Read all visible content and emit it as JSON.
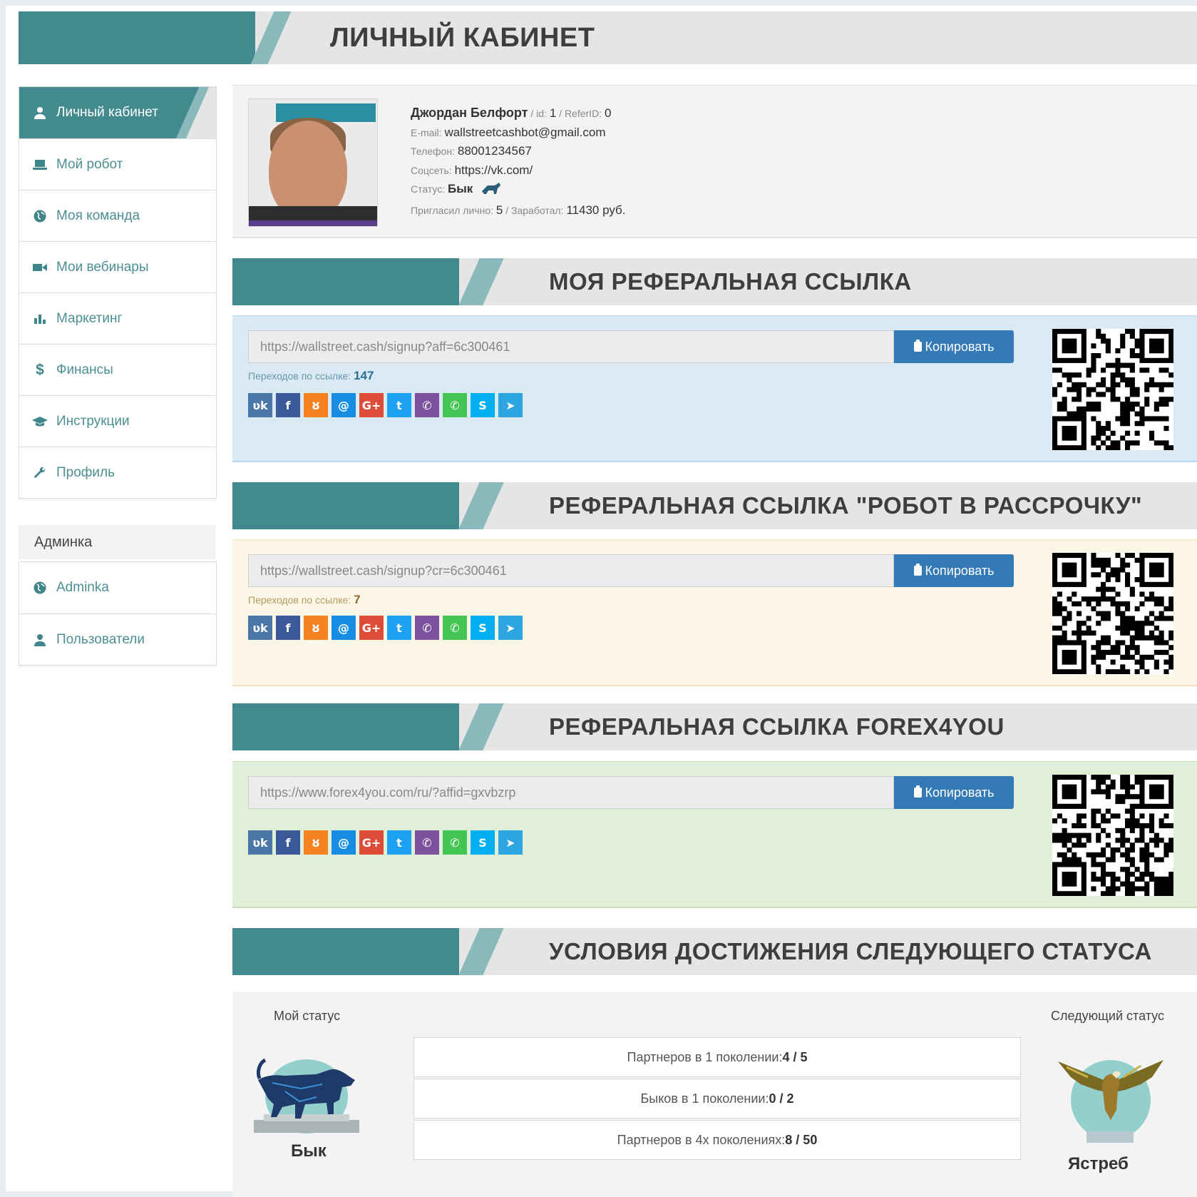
{
  "header": {
    "title": "ЛИЧНЫЙ КАБИНЕТ"
  },
  "sidebar": {
    "items": [
      {
        "label": "Личный кабинет",
        "icon": "user-icon"
      },
      {
        "label": "Мой робот",
        "icon": "laptop-icon"
      },
      {
        "label": "Моя команда",
        "icon": "globe-icon"
      },
      {
        "label": "Мои вебинары",
        "icon": "video-camera-icon"
      },
      {
        "label": "Маркетинг",
        "icon": "bar-chart-icon"
      },
      {
        "label": "Финансы",
        "icon": "dollar-icon"
      },
      {
        "label": "Инструкции",
        "icon": "graduation-cap-icon"
      },
      {
        "label": "Профиль",
        "icon": "wrench-icon"
      }
    ],
    "admin_heading": "Админка",
    "admin_items": [
      {
        "label": "Adminka",
        "icon": "globe-icon"
      },
      {
        "label": "Пользователи",
        "icon": "user-icon"
      }
    ]
  },
  "profile": {
    "name": "Джордан Белфорт",
    "id_label": " / id: ",
    "id": "1",
    "referid_label": " / ReferID: ",
    "referid": "0",
    "email_label": "E-mail: ",
    "email": "wallstreetcashbot@gmail.com",
    "phone_label": "Телефон: ",
    "phone": "88001234567",
    "social_label": "Соцсеть: ",
    "social": "https://vk.com/",
    "status_label": "Статус: ",
    "status": "Бык",
    "invited_label": "Пригласил лично: ",
    "invited": "5",
    "earned_label": " / Заработал: ",
    "earned": "11430 руб."
  },
  "sections": {
    "ref1": {
      "title": "МОЯ РЕФЕРАЛЬНАЯ ССЫЛКА",
      "url": "https://wallstreet.cash/signup?aff=6c300461",
      "copy": "Копировать",
      "transitions_label": "Переходов по ссылке: ",
      "transitions": "147"
    },
    "ref2": {
      "title": "РЕФЕРАЛЬНАЯ ССЫЛКА \"РОБОТ В РАССРОЧКУ\"",
      "url": "https://wallstreet.cash/signup?cr=6c300461",
      "copy": "Копировать",
      "transitions_label": "Переходов по ссылке: ",
      "transitions": "7"
    },
    "ref3": {
      "title": "РЕФЕРАЛЬНАЯ ССЫЛКА FOREX4YOU",
      "url": "https://www.forex4you.com/ru/?affid=gxvbzrp",
      "copy": "Копировать"
    },
    "status": {
      "title": "УСЛОВИЯ ДОСТИЖЕНИЯ СЛЕДУЮЩЕГО СТАТУСА",
      "my_status_caption": "Мой статус",
      "my_status": "Бык",
      "next_status_caption": "Следующий статус",
      "next_status": "Ястреб",
      "conditions": [
        {
          "label": "Партнеров в 1 поколении: ",
          "value": "4 / 5"
        },
        {
          "label": "Быков в 1 поколении: ",
          "value": "0 / 2"
        },
        {
          "label": "Партнеров в 4х поколениях: ",
          "value": "8 / 50"
        }
      ]
    }
  },
  "social_buttons": [
    {
      "name": "vk-icon",
      "glyph": "ʋk",
      "color": "#4a76a8"
    },
    {
      "name": "facebook-icon",
      "glyph": "f",
      "color": "#3b5998"
    },
    {
      "name": "odnoklassniki-icon",
      "glyph": "ȣ",
      "color": "#f58220"
    },
    {
      "name": "moimir-icon",
      "glyph": "@",
      "color": "#168de2"
    },
    {
      "name": "google-plus-icon",
      "glyph": "G+",
      "color": "#dd4b39"
    },
    {
      "name": "twitter-icon",
      "glyph": "t",
      "color": "#1da1f2"
    },
    {
      "name": "viber-icon",
      "glyph": "✆",
      "color": "#7b519d"
    },
    {
      "name": "whatsapp-icon",
      "glyph": "✆",
      "color": "#43c553"
    },
    {
      "name": "skype-icon",
      "glyph": "S",
      "color": "#00aff0"
    },
    {
      "name": "telegram-icon",
      "glyph": "➤",
      "color": "#2ca5e0"
    }
  ],
  "colors": {
    "teal": "#428a8e",
    "ref1_bg": "#d9eaf4",
    "ref2_bg": "#fcf6e6",
    "ref3_bg": "#dfefd8",
    "copy_button": "#337ab7"
  }
}
